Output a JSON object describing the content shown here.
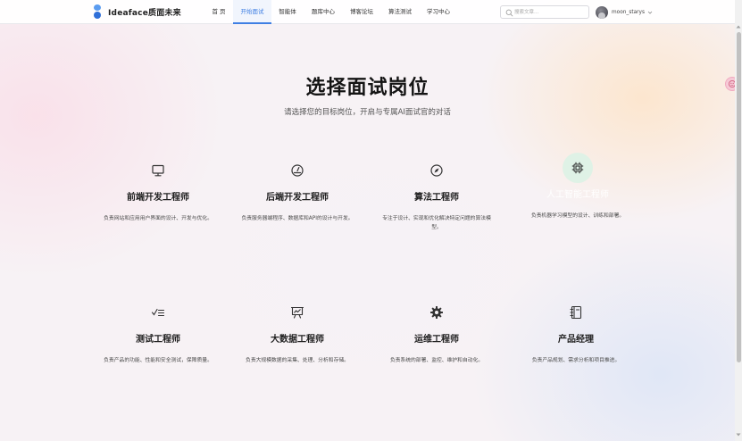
{
  "header": {
    "brand": "Ideaface质面未来",
    "nav": [
      {
        "label": "首 页"
      },
      {
        "label": "开始面试"
      },
      {
        "label": "智能体"
      },
      {
        "label": "题库中心"
      },
      {
        "label": "博客论坛"
      },
      {
        "label": "算法测试"
      },
      {
        "label": "学习中心"
      }
    ],
    "active_nav": "开始面试",
    "search_placeholder": "搜索文章...",
    "username": "moon_starys"
  },
  "main": {
    "title": "选择面试岗位",
    "subtitle": "请选择您的目标岗位，开启与专属AI面试官的对话",
    "positions": [
      {
        "title": "前端开发工程师",
        "desc": "负责网站和应用用户界面的设计、开发与优化。",
        "icon": "monitor-icon"
      },
      {
        "title": "后端开发工程师",
        "desc": "负责服务器端程序、数据库和API的设计与开发。",
        "icon": "gauge-icon"
      },
      {
        "title": "算法工程师",
        "desc": "专注于设计、实现和优化解决特定问题的算法模型。",
        "icon": "compass-icon"
      },
      {
        "title": "人工智能工程师",
        "desc": "负责机器学习模型的设计、训练和部署。",
        "icon": "chip-icon"
      },
      {
        "title": "测试工程师",
        "desc": "负责产品的功能、性能和安全测试，保障质量。",
        "icon": "checklist-icon"
      },
      {
        "title": "大数据工程师",
        "desc": "负责大规模数据的采集、处理、分析和存储。",
        "icon": "presentation-chart-icon"
      },
      {
        "title": "运维工程师",
        "desc": "负责系统的部署、监控、维护和自动化。",
        "icon": "gear-icon"
      },
      {
        "title": "产品经理",
        "desc": "负责产品规划、需求分析和项目推进。",
        "icon": "notebook-icon"
      }
    ]
  },
  "colors": {
    "accent": "#3f7fe3",
    "hover_icon_bg": "#dff2e6"
  }
}
